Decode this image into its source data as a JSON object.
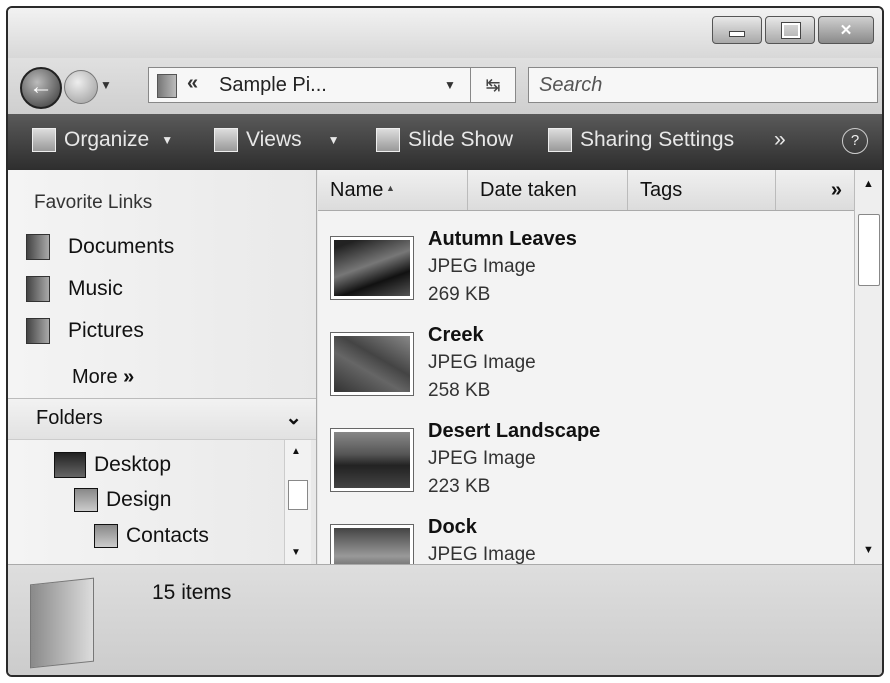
{
  "window": {
    "caption_buttons": [
      "minimize",
      "maximize",
      "close"
    ]
  },
  "address": {
    "separator": "«",
    "path": "Sample Pi...",
    "refresh_icon": "refresh-arrows-icon"
  },
  "search": {
    "placeholder": "Search"
  },
  "toolbar": {
    "organize": "Organize",
    "views": "Views",
    "slideshow": "Slide Show",
    "sharing": "Sharing Settings",
    "overflow": "»",
    "help": "?"
  },
  "favorites": {
    "header": "Favorite Links",
    "items": [
      {
        "label": "Documents",
        "icon": "documents-icon"
      },
      {
        "label": "Music",
        "icon": "music-icon"
      },
      {
        "label": "Pictures",
        "icon": "pictures-icon"
      }
    ],
    "more": "More",
    "more_glyph": "»"
  },
  "folders": {
    "header": "Folders",
    "tree": [
      {
        "label": "Desktop",
        "icon": "desktop-icon"
      },
      {
        "label": "Design",
        "icon": "folder-icon"
      },
      {
        "label": "Contacts",
        "icon": "contacts-icon"
      }
    ]
  },
  "columns": [
    "Name",
    "Date taken",
    "Tags",
    "»"
  ],
  "files": [
    {
      "name": "Autumn Leaves",
      "type": "JPEG Image",
      "size": "269 KB"
    },
    {
      "name": "Creek",
      "type": "JPEG Image",
      "size": "258 KB"
    },
    {
      "name": "Desert Landscape",
      "type": "JPEG Image",
      "size": "223 KB"
    },
    {
      "name": "Dock",
      "type": "JPEG Image",
      "size": ""
    }
  ],
  "status": {
    "count": "15 items"
  }
}
